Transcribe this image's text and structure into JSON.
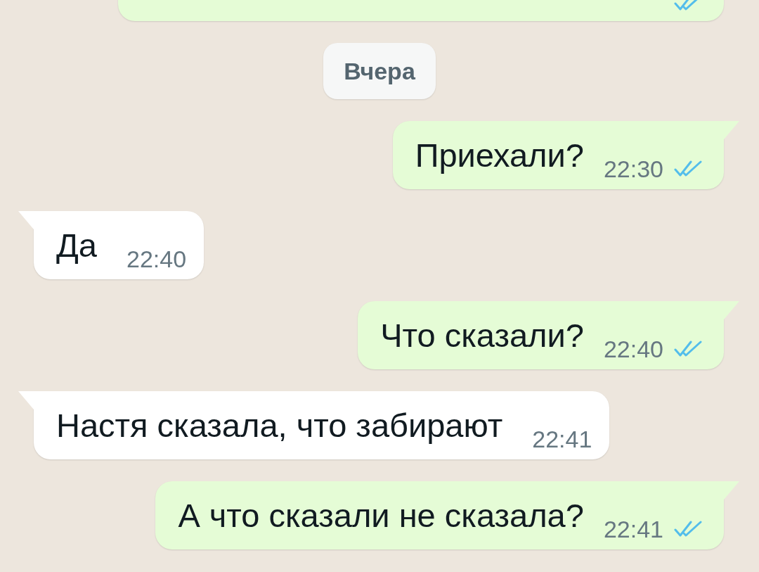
{
  "chat": {
    "items": [
      {
        "kind": "message",
        "outgoing": true,
        "cut_off": true,
        "read": true
      },
      {
        "kind": "date",
        "label": "Вчера"
      },
      {
        "kind": "message",
        "outgoing": true,
        "text": "Приехали?",
        "time": "22:30",
        "read": true
      },
      {
        "kind": "message",
        "outgoing": false,
        "text": "Да",
        "time": "22:40"
      },
      {
        "kind": "message",
        "outgoing": true,
        "text": "Что сказали?",
        "time": "22:40",
        "read": true
      },
      {
        "kind": "message",
        "outgoing": false,
        "text": "Настя сказала, что забирают",
        "time": "22:41"
      },
      {
        "kind": "message",
        "outgoing": true,
        "text": "А что сказали не сказала?",
        "time": "22:41",
        "read": true
      }
    ]
  }
}
